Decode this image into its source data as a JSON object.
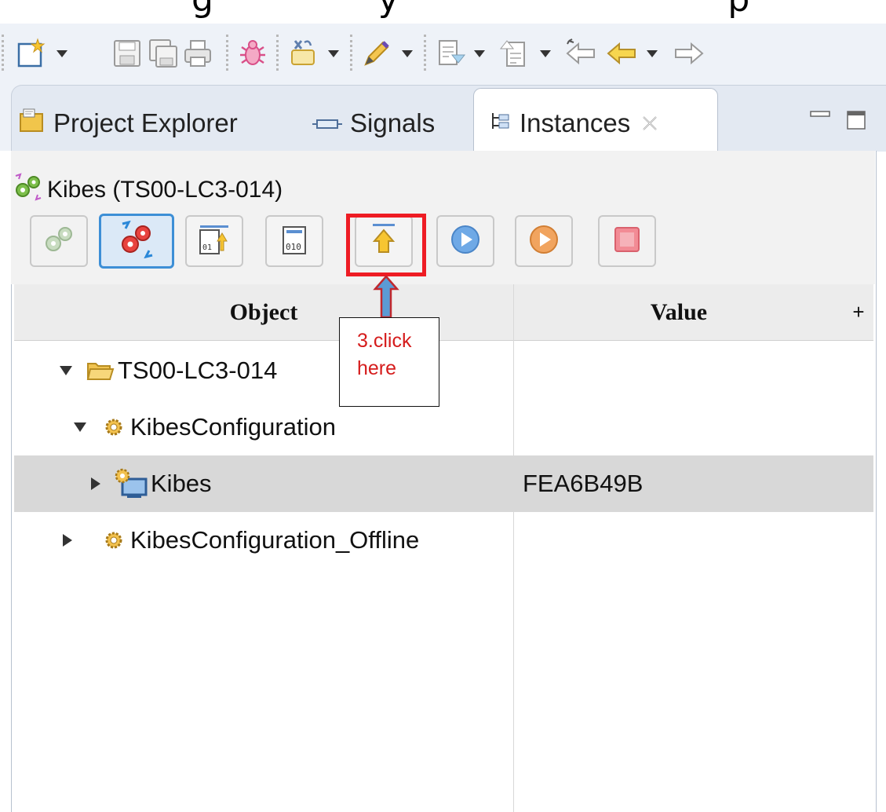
{
  "cut_off_text": "(text cut off at top of image)",
  "main_toolbar": {
    "items": [
      {
        "name": "new-icon"
      },
      {
        "name": "save-icon"
      },
      {
        "name": "save-all-icon"
      },
      {
        "name": "print-icon"
      },
      {
        "name": "debug-icon"
      },
      {
        "name": "refactor-icon"
      },
      {
        "name": "pen-icon"
      },
      {
        "name": "next-annotation-icon"
      },
      {
        "name": "previous-annotation-icon"
      },
      {
        "name": "last-edit-icon"
      },
      {
        "name": "back-icon"
      },
      {
        "name": "forward-icon"
      }
    ]
  },
  "tabs": [
    {
      "label": "Project Explorer",
      "icon": "project-explorer-icon"
    },
    {
      "label": "Signals",
      "icon": "signals-icon"
    },
    {
      "label": "Instances",
      "icon": "instances-icon",
      "active": true,
      "close_icon": "close-icon"
    }
  ],
  "view_controls": {
    "minimize": "minimize-icon",
    "maximize": "maximize-icon"
  },
  "view_title": "Kibes (TS00-LC3-014)",
  "view_toolbar": [
    {
      "name": "disconnect-icon",
      "state": "disabled"
    },
    {
      "name": "connect-icon",
      "state": "pressed"
    },
    {
      "name": "upload-binary-icon",
      "state": "normal"
    },
    {
      "name": "download-binary-icon",
      "state": "normal"
    },
    {
      "name": "upload-icon",
      "state": "normal"
    },
    {
      "name": "start-icon",
      "state": "disabled"
    },
    {
      "name": "restart-icon",
      "state": "disabled"
    },
    {
      "name": "stop-icon",
      "state": "disabled"
    }
  ],
  "table": {
    "columns": [
      "Object",
      "Value"
    ],
    "add_column": "+",
    "rows": [
      {
        "object": "TS00-LC3-014",
        "value": "",
        "expanded": true,
        "icon": "folder-open-icon"
      },
      {
        "object": "KibesConfiguration",
        "value": "",
        "expanded": true,
        "icon": "gear-icon"
      },
      {
        "object": "Kibes",
        "value": "FEA6B49B",
        "expanded": false,
        "icon": "device-icon",
        "selected": true
      },
      {
        "object": "KibesConfiguration_Offline",
        "value": "",
        "expanded": false,
        "icon": "gear-icon"
      }
    ]
  },
  "annotation": {
    "line1": "3.click",
    "line2": "here",
    "highlight_color": "#ee1c24",
    "text_color": "#d51c1c"
  },
  "colors": {
    "toolbar_bg": "#eef2f8",
    "selected_row": "#d8d8d8",
    "accent_blue": "#3d8fd6"
  }
}
